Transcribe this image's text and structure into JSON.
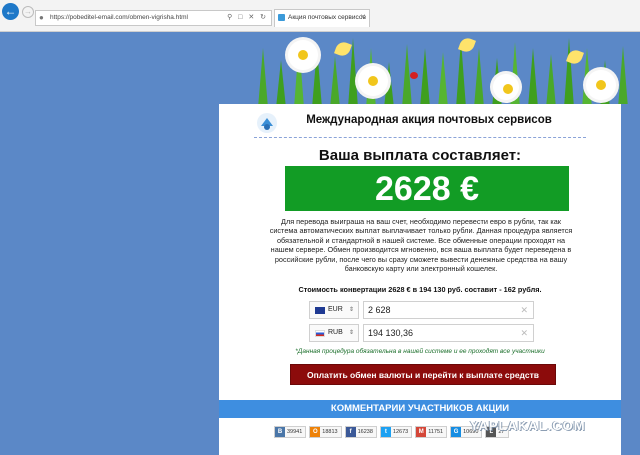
{
  "browser": {
    "url": "https://pobeditel-email.com/obmen-vigrisha.html",
    "tab_title": "Акция почтовых сервисов"
  },
  "page": {
    "site_title": "Международная акция почтовых сервисов",
    "payout_title": "Ваша выплата составляет:",
    "payout_amount": "2628 €",
    "description": "Для перевода выиграша на ваш счет, необходимо перевести евро в рубли, так как система автоматических выплат выплачивает только рубли. Данная процедура является обязательной и стандартной в нашей системе. Все обменные операции проходят на нашем сервере. Обмен производится мгновенно, вся ваша выплата будет переведена в российские рубли, после чего вы сразу сможете вывести денежные средства на вашу банковскую карту или электронный кошелек.",
    "conversion_cost": "Стоимость конвертации 2628 € в 194 130 руб. составит - 162 рубля.",
    "converter": [
      {
        "currency": "EUR",
        "value": "2 628"
      },
      {
        "currency": "RUB",
        "value": "194 130,36"
      }
    ],
    "note": "*Данная процедура обязательна в нашей системе и ее проходят все участники",
    "pay_button": "Оплатить обмен валюты и перейти к выплате средств",
    "comments_header": "КОММЕНТАРИИ УЧАСТНИКОВ АКЦИИ",
    "shares": [
      {
        "icon": "B",
        "count": "39941",
        "color": "#4a76a8"
      },
      {
        "icon": "O",
        "count": "18813",
        "color": "#ee8208"
      },
      {
        "icon": "f",
        "count": "16238",
        "color": "#3b5998"
      },
      {
        "icon": "t",
        "count": "12673",
        "color": "#1da1f2"
      },
      {
        "icon": "M",
        "count": "11751",
        "color": "#d44638"
      },
      {
        "icon": "G",
        "count": "10690",
        "color": "#168de2"
      },
      {
        "icon": "L",
        "count": "27",
        "color": "#555555"
      }
    ]
  },
  "watermark": "YAPLAKAL.COM"
}
